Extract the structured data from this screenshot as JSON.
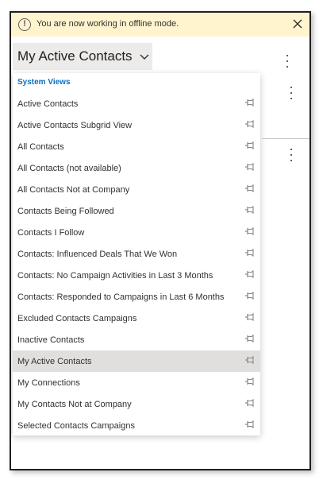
{
  "banner": {
    "message": "You are now working in offline mode.",
    "warning_icon": "warning-circle-icon",
    "close_icon": "close-icon"
  },
  "view_selector": {
    "title": "My Active Contacts",
    "chevron_icon": "chevron-down-icon"
  },
  "dropdown": {
    "group_header": "System Views",
    "pin_icon": "pin-icon",
    "items": [
      {
        "label": "Active Contacts",
        "selected": false
      },
      {
        "label": "Active Contacts Subgrid View",
        "selected": false
      },
      {
        "label": "All Contacts",
        "selected": false
      },
      {
        "label": "All Contacts (not available)",
        "selected": false
      },
      {
        "label": "All Contacts Not at Company",
        "selected": false
      },
      {
        "label": "Contacts Being Followed",
        "selected": false
      },
      {
        "label": "Contacts I Follow",
        "selected": false
      },
      {
        "label": "Contacts: Influenced Deals That We Won",
        "selected": false
      },
      {
        "label": "Contacts: No Campaign Activities in Last 3 Months",
        "selected": false
      },
      {
        "label": "Contacts: Responded to Campaigns in Last 6 Months",
        "selected": false
      },
      {
        "label": "Excluded Contacts Campaigns",
        "selected": false
      },
      {
        "label": "Inactive Contacts",
        "selected": false
      },
      {
        "label": "My Active Contacts",
        "selected": true
      },
      {
        "label": "My Connections",
        "selected": false
      },
      {
        "label": "My Contacts Not at Company",
        "selected": false
      },
      {
        "label": "Selected Contacts Campaigns",
        "selected": false
      }
    ]
  },
  "colors": {
    "banner_bg": "#fff4ce",
    "header_accent": "#106ebe",
    "selected_bg": "#e1dfdd"
  }
}
